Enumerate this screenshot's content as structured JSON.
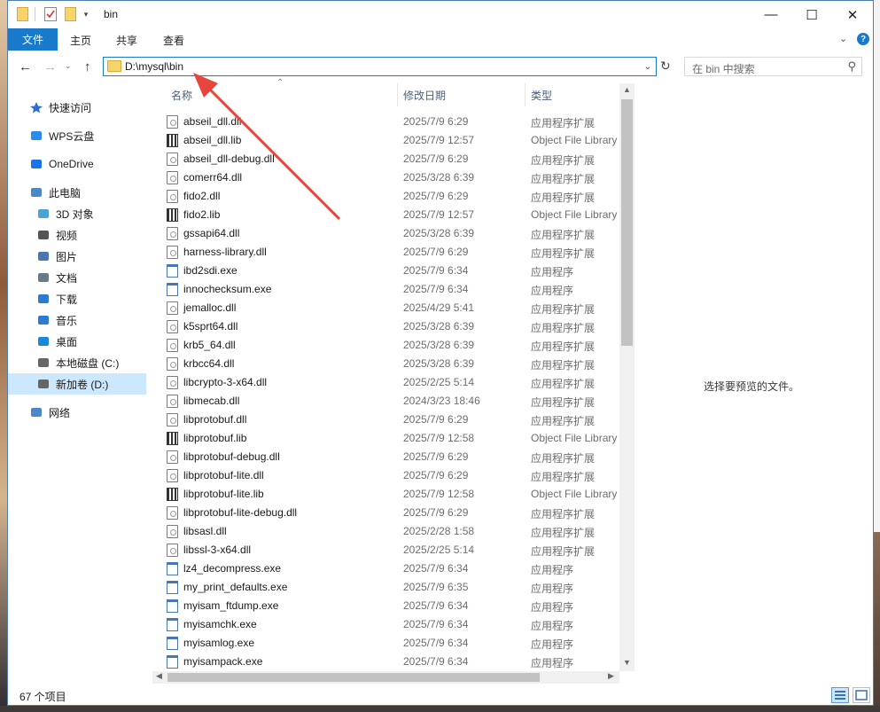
{
  "window": {
    "title": "bin",
    "controls": {
      "minimize": "—",
      "maximize": "☐",
      "close": "✕"
    }
  },
  "ribbon": {
    "tabs": [
      "文件",
      "主页",
      "共享",
      "查看"
    ]
  },
  "address": {
    "path": "D:\\mysql\\bin",
    "search_placeholder": "在 bin 中搜索"
  },
  "nav": {
    "items": [
      {
        "label": "快速访问",
        "icon": "star-icon"
      },
      {
        "label": "WPS云盘",
        "icon": "cloud-icon"
      },
      {
        "label": "OneDrive",
        "icon": "onedrive-icon"
      },
      {
        "label": "此电脑",
        "icon": "pc-icon"
      },
      {
        "label": "3D 对象",
        "icon": "cube-icon"
      },
      {
        "label": "视频",
        "icon": "video-icon"
      },
      {
        "label": "图片",
        "icon": "picture-icon"
      },
      {
        "label": "文档",
        "icon": "document-icon"
      },
      {
        "label": "下载",
        "icon": "download-icon"
      },
      {
        "label": "音乐",
        "icon": "music-icon"
      },
      {
        "label": "桌面",
        "icon": "desktop-icon"
      },
      {
        "label": "本地磁盘 (C:)",
        "icon": "drive-icon"
      },
      {
        "label": "新加卷 (D:)",
        "icon": "drive-icon",
        "selected": true
      },
      {
        "label": "网络",
        "icon": "network-icon"
      }
    ]
  },
  "columns": {
    "name": "名称",
    "date": "修改日期",
    "type": "类型"
  },
  "files": [
    {
      "name": "abseil_dll.dll",
      "date": "2025/7/9 6:29",
      "type": "应用程序扩展",
      "kind": "dll"
    },
    {
      "name": "abseil_dll.lib",
      "date": "2025/7/9 12:57",
      "type": "Object File Library",
      "kind": "lib"
    },
    {
      "name": "abseil_dll-debug.dll",
      "date": "2025/7/9 6:29",
      "type": "应用程序扩展",
      "kind": "dll"
    },
    {
      "name": "comerr64.dll",
      "date": "2025/3/28 6:39",
      "type": "应用程序扩展",
      "kind": "dll"
    },
    {
      "name": "fido2.dll",
      "date": "2025/7/9 6:29",
      "type": "应用程序扩展",
      "kind": "dll"
    },
    {
      "name": "fido2.lib",
      "date": "2025/7/9 12:57",
      "type": "Object File Library",
      "kind": "lib"
    },
    {
      "name": "gssapi64.dll",
      "date": "2025/3/28 6:39",
      "type": "应用程序扩展",
      "kind": "dll"
    },
    {
      "name": "harness-library.dll",
      "date": "2025/7/9 6:29",
      "type": "应用程序扩展",
      "kind": "dll"
    },
    {
      "name": "ibd2sdi.exe",
      "date": "2025/7/9 6:34",
      "type": "应用程序",
      "kind": "exe"
    },
    {
      "name": "innochecksum.exe",
      "date": "2025/7/9 6:34",
      "type": "应用程序",
      "kind": "exe"
    },
    {
      "name": "jemalloc.dll",
      "date": "2025/4/29 5:41",
      "type": "应用程序扩展",
      "kind": "dll"
    },
    {
      "name": "k5sprt64.dll",
      "date": "2025/3/28 6:39",
      "type": "应用程序扩展",
      "kind": "dll"
    },
    {
      "name": "krb5_64.dll",
      "date": "2025/3/28 6:39",
      "type": "应用程序扩展",
      "kind": "dll"
    },
    {
      "name": "krbcc64.dll",
      "date": "2025/3/28 6:39",
      "type": "应用程序扩展",
      "kind": "dll"
    },
    {
      "name": "libcrypto-3-x64.dll",
      "date": "2025/2/25 5:14",
      "type": "应用程序扩展",
      "kind": "dll"
    },
    {
      "name": "libmecab.dll",
      "date": "2024/3/23 18:46",
      "type": "应用程序扩展",
      "kind": "dll"
    },
    {
      "name": "libprotobuf.dll",
      "date": "2025/7/9 6:29",
      "type": "应用程序扩展",
      "kind": "dll"
    },
    {
      "name": "libprotobuf.lib",
      "date": "2025/7/9 12:58",
      "type": "Object File Library",
      "kind": "lib"
    },
    {
      "name": "libprotobuf-debug.dll",
      "date": "2025/7/9 6:29",
      "type": "应用程序扩展",
      "kind": "dll"
    },
    {
      "name": "libprotobuf-lite.dll",
      "date": "2025/7/9 6:29",
      "type": "应用程序扩展",
      "kind": "dll"
    },
    {
      "name": "libprotobuf-lite.lib",
      "date": "2025/7/9 12:58",
      "type": "Object File Library",
      "kind": "lib"
    },
    {
      "name": "libprotobuf-lite-debug.dll",
      "date": "2025/7/9 6:29",
      "type": "应用程序扩展",
      "kind": "dll"
    },
    {
      "name": "libsasl.dll",
      "date": "2025/2/28 1:58",
      "type": "应用程序扩展",
      "kind": "dll"
    },
    {
      "name": "libssl-3-x64.dll",
      "date": "2025/2/25 5:14",
      "type": "应用程序扩展",
      "kind": "dll"
    },
    {
      "name": "lz4_decompress.exe",
      "date": "2025/7/9 6:34",
      "type": "应用程序",
      "kind": "exe"
    },
    {
      "name": "my_print_defaults.exe",
      "date": "2025/7/9 6:35",
      "type": "应用程序",
      "kind": "exe"
    },
    {
      "name": "myisam_ftdump.exe",
      "date": "2025/7/9 6:34",
      "type": "应用程序",
      "kind": "exe"
    },
    {
      "name": "myisamchk.exe",
      "date": "2025/7/9 6:34",
      "type": "应用程序",
      "kind": "exe"
    },
    {
      "name": "myisamlog.exe",
      "date": "2025/7/9 6:34",
      "type": "应用程序",
      "kind": "exe"
    },
    {
      "name": "myisampack.exe",
      "date": "2025/7/9 6:34",
      "type": "应用程序",
      "kind": "exe"
    }
  ],
  "preview": {
    "message": "选择要预览的文件。"
  },
  "status": {
    "count": "67 个项目"
  },
  "colors": {
    "accent": "#1979ca",
    "selected": "#cce8ff",
    "annotation_arrow": "#e8453c"
  }
}
